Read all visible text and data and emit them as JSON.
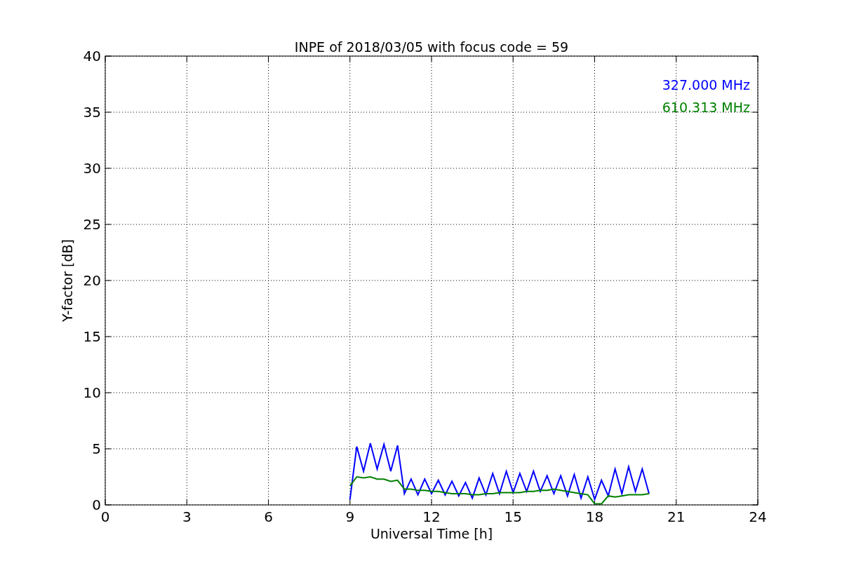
{
  "chart_data": {
    "type": "line",
    "title": "INPE of 2018/03/05 with focus code = 59",
    "xlabel": "Universal Time [h]",
    "ylabel": "Y-factor [dB]",
    "x": [
      9.0,
      9.25,
      9.5,
      9.75,
      10.0,
      10.25,
      10.5,
      10.75,
      11.0,
      11.25,
      11.5,
      11.75,
      12.0,
      12.25,
      12.5,
      12.75,
      13.0,
      13.25,
      13.5,
      13.75,
      14.0,
      14.25,
      14.5,
      14.75,
      15.0,
      15.25,
      15.5,
      15.75,
      16.0,
      16.25,
      16.5,
      16.75,
      17.0,
      17.25,
      17.5,
      17.75,
      18.0,
      18.25,
      18.5,
      18.75,
      19.0,
      19.25,
      19.5,
      19.75,
      20.0
    ],
    "series": [
      {
        "name": "327.000 MHz",
        "color": "#0000ff",
        "values": [
          0.5,
          5.2,
          3.0,
          5.5,
          3.2,
          5.4,
          3.0,
          5.3,
          1.0,
          2.3,
          0.9,
          2.3,
          1.0,
          2.2,
          0.9,
          2.1,
          0.8,
          2.0,
          0.6,
          2.4,
          0.9,
          2.8,
          1.0,
          3.0,
          1.1,
          2.8,
          1.2,
          3.0,
          1.2,
          2.6,
          1.0,
          2.6,
          0.8,
          2.7,
          0.6,
          2.5,
          0.5,
          2.2,
          0.8,
          3.2,
          1.0,
          3.4,
          1.2,
          3.2,
          1.0
        ]
      },
      {
        "name": "610.313 MHz",
        "color": "#008000",
        "values": [
          1.7,
          2.5,
          2.4,
          2.5,
          2.3,
          2.3,
          2.1,
          2.2,
          1.4,
          1.4,
          1.3,
          1.3,
          1.2,
          1.2,
          1.1,
          1.0,
          1.0,
          1.0,
          0.9,
          0.9,
          1.0,
          1.0,
          1.1,
          1.1,
          1.1,
          1.1,
          1.2,
          1.2,
          1.3,
          1.3,
          1.4,
          1.3,
          1.2,
          1.1,
          1.0,
          0.9,
          0.1,
          0.1,
          0.8,
          0.7,
          0.8,
          0.9,
          0.9,
          0.9,
          1.0
        ]
      }
    ],
    "grid": true,
    "xlim": [
      0,
      24
    ],
    "ylim": [
      0,
      40
    ],
    "xticks": [
      0,
      3,
      6,
      9,
      12,
      15,
      18,
      21,
      24
    ],
    "yticks": [
      0,
      5,
      10,
      15,
      20,
      25,
      30,
      35,
      40
    ]
  }
}
